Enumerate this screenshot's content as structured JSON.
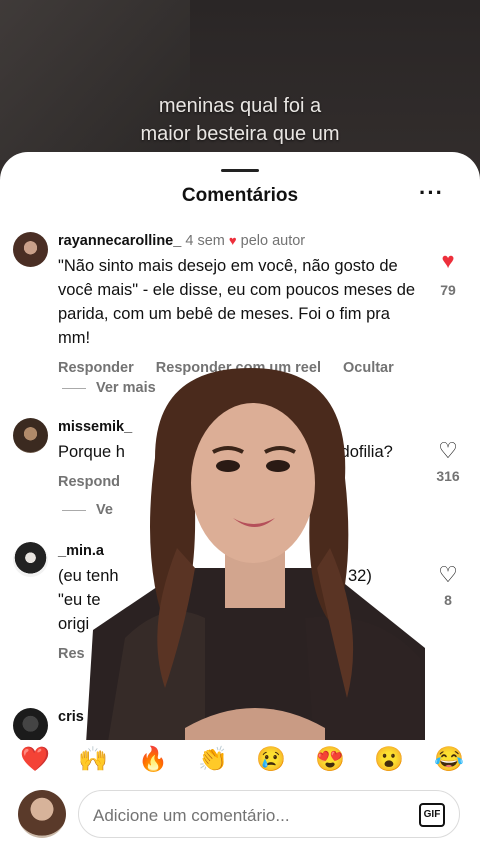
{
  "video": {
    "caption_line1": "meninas qual foi a",
    "caption_line2": "maior besteira que um"
  },
  "sheet": {
    "title": "Comentários",
    "more_icon": "ellipsis-icon"
  },
  "comments": [
    {
      "username": "rayannecarolline_",
      "time": "4 sem",
      "by_author": "pelo autor",
      "text": "\"Não sinto mais desejo em você, não gosto de você mais\" - ele disse, eu com poucos meses de parida, com um bebê de meses. Foi o fim pra mm!",
      "reply": "Responder",
      "reply_reel": "Responder com um reel",
      "hide": "Ocultar",
      "view_more": "Ver mais",
      "likes": "79",
      "liked": true
    },
    {
      "username": "missemik_",
      "text_left": "Porque h",
      "text_right": "mal pedofilia?",
      "reply": "Respond",
      "view_more": "Ve",
      "likes": "316",
      "liked": false
    },
    {
      "username": "_min.a",
      "line1_left": "(eu tenh",
      "line1_right": "32)",
      "line2": "\"eu te",
      "line3": "origi",
      "reply": "Res",
      "likes": "8",
      "liked": false
    },
    {
      "username": "cris"
    }
  ],
  "emojis": [
    "❤️",
    "🙌",
    "🔥",
    "👏",
    "😢",
    "😍",
    "😮",
    "😂"
  ],
  "input": {
    "placeholder": "Adicione um comentário...",
    "gif_label": "GIF"
  },
  "colors": {
    "like_red": "#ed2f3b",
    "muted_text": "#737373"
  }
}
